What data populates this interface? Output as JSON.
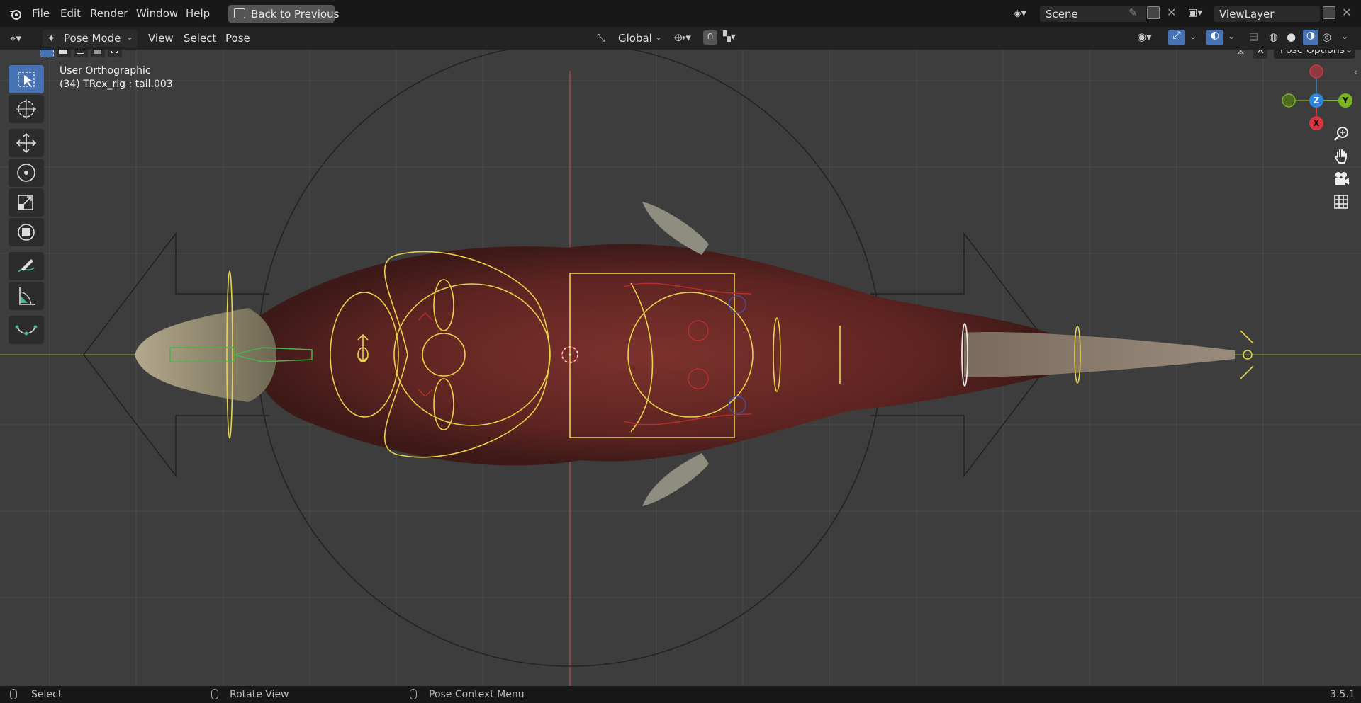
{
  "menubar": {
    "items": [
      "File",
      "Edit",
      "Render",
      "Window",
      "Help"
    ],
    "back_button": "Back to Previous",
    "scene_name": "Scene",
    "view_layer": "ViewLayer"
  },
  "header": {
    "mode": "Pose Mode",
    "menus": [
      "View",
      "Select",
      "Pose"
    ],
    "orientation": "Global",
    "pose_options": "Pose Options",
    "x_mirror": "X"
  },
  "viewport": {
    "view_name": "User Orthographic",
    "object_info": "(34) TRex_rig : tail.003",
    "gizmo_axes": [
      "Z",
      "Y",
      "X"
    ]
  },
  "statusbar": {
    "select": "Select",
    "rotate_view": "Rotate View",
    "context_menu": "Pose Context Menu",
    "version": "3.5.1"
  },
  "colors": {
    "selection_active": "#4772b3",
    "rig_yellow": "#e8d24a",
    "axis_red": "#d9343f",
    "axis_green": "#7ab51d",
    "axis_blue": "#2e86de",
    "fur": "#6b2a26"
  },
  "icons": [
    "blender-logo-icon",
    "editor-type-icon",
    "pose-mode-icon",
    "transform-orientation-icon",
    "pivot-icon",
    "snap-icon",
    "visibility-icon",
    "gizmo-icon",
    "overlay-icon",
    "xray-icon",
    "shading-icon",
    "zoom-icon",
    "hand-icon",
    "camera-icon",
    "grid-icon"
  ]
}
